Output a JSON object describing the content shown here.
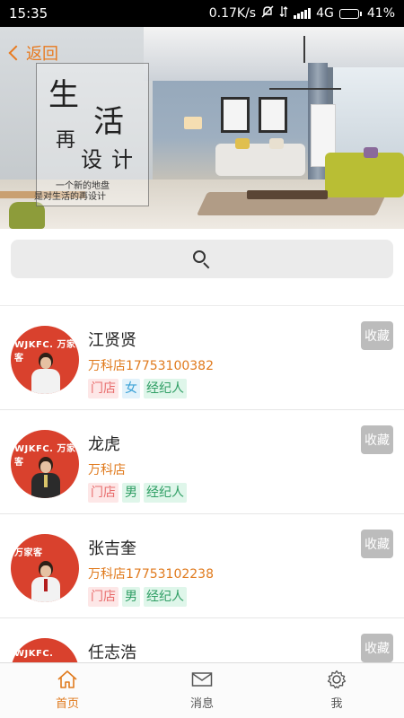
{
  "status_bar": {
    "time": "15:35",
    "speed": "0.17K/s",
    "network": "4G",
    "battery": "41%",
    "battery_level": 0.41
  },
  "header": {
    "back_label": "返回"
  },
  "banner": {
    "title_chars": [
      "生",
      "活",
      "再",
      "设",
      "计"
    ],
    "slogan_line1": "一个新的地盘",
    "slogan_line2": "是对生活的再设计"
  },
  "search": {
    "icon": "search-icon"
  },
  "agents": [
    {
      "name": "江贤贤",
      "store": "万科店17753100382",
      "tags": [
        "门店",
        "女",
        "经纪人"
      ],
      "favorite_label": "收藏"
    },
    {
      "name": "龙虎",
      "store": "万科店",
      "tags": [
        "门店",
        "男",
        "经纪人"
      ],
      "favorite_label": "收藏"
    },
    {
      "name": "张吉奎",
      "store": "万科店17753102238",
      "tags": [
        "门店",
        "男",
        "经纪人"
      ],
      "favorite_label": "收藏"
    },
    {
      "name": "任志浩",
      "store": "",
      "tags": [],
      "favorite_label": "收藏"
    }
  ],
  "avatar_brands": [
    "WJKFC. 万家客",
    "WJKFC. 万家客",
    "万家客",
    "WJKFC."
  ],
  "bottom_nav": [
    {
      "label": "首页",
      "icon": "home-icon",
      "active": true
    },
    {
      "label": "消息",
      "icon": "mail-icon",
      "active": false
    },
    {
      "label": "我",
      "icon": "gear-icon",
      "active": false
    }
  ],
  "colors": {
    "accent": "#e07a1d",
    "favorite_bg": "#bcbcbc",
    "status_bar_bg": "#000000"
  }
}
